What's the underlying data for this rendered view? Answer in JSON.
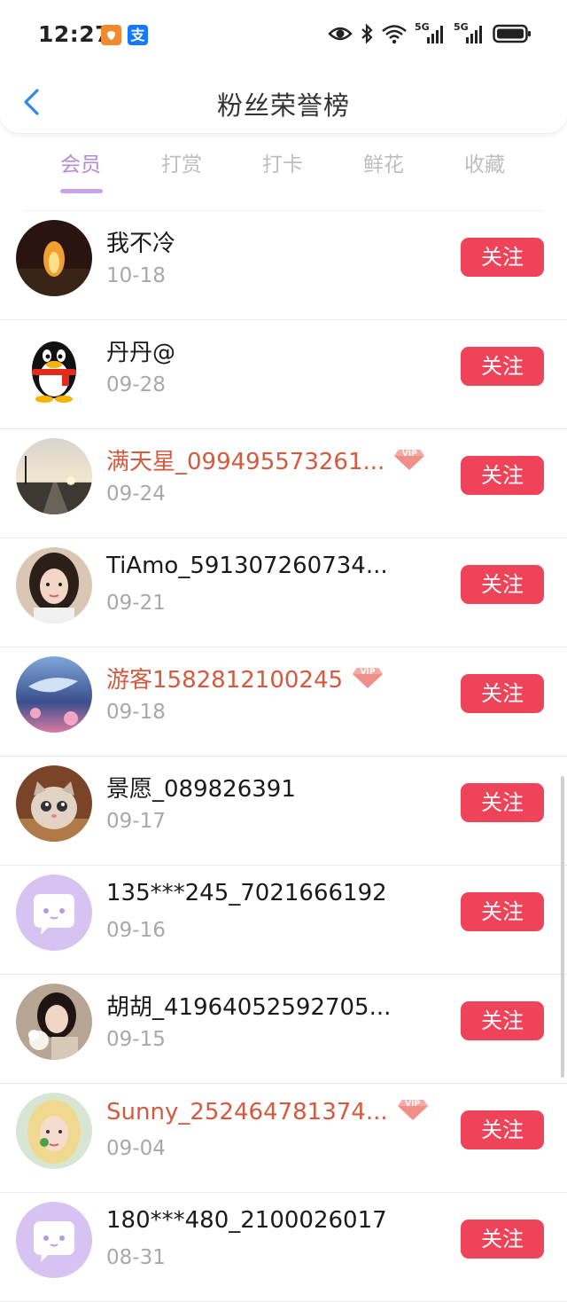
{
  "status_bar": {
    "time": "12:27",
    "alipay_glyph": "支",
    "icons": [
      "eye-icon",
      "bluetooth-icon",
      "wifi-icon",
      "signal-5g-icon",
      "signal-5g-icon",
      "battery-icon"
    ],
    "network_label": "5G"
  },
  "header": {
    "title": "粉丝荣誉榜"
  },
  "tabs": [
    {
      "label": "会员",
      "active": true
    },
    {
      "label": "打赏",
      "active": false
    },
    {
      "label": "打卡",
      "active": false
    },
    {
      "label": "鲜花",
      "active": false
    },
    {
      "label": "收藏",
      "active": false
    }
  ],
  "follow_label": "关注",
  "vip_badge": "VIP",
  "fans": [
    {
      "name": "我不冷",
      "date": "10-18",
      "vip": false,
      "avatar": "fire-photo"
    },
    {
      "name": "丹丹@",
      "date": "09-28",
      "vip": false,
      "avatar": "qq-penguin"
    },
    {
      "name": "满天星_099495573261...",
      "date": "09-24",
      "vip": true,
      "avatar": "sunset-railway-photo"
    },
    {
      "name": "TiAmo_591307260734...",
      "date": "09-21",
      "vip": false,
      "avatar": "girl-portrait-photo"
    },
    {
      "name": "游客1582812100245",
      "date": "09-18",
      "vip": true,
      "avatar": "whale-art-photo"
    },
    {
      "name": "景愿_089826391",
      "date": "09-17",
      "vip": false,
      "avatar": "kitten-photo"
    },
    {
      "name": "135***245_7021666192",
      "date": "09-16",
      "vip": false,
      "avatar": "default-chat-avatar"
    },
    {
      "name": "胡胡_41964052592705...",
      "date": "09-15",
      "vip": false,
      "avatar": "girl-flowers-photo"
    },
    {
      "name": "Sunny_252464781374...",
      "date": "09-04",
      "vip": true,
      "avatar": "blonde-girl-photo"
    },
    {
      "name": "180***480_2100026017",
      "date": "08-31",
      "vip": false,
      "avatar": "default-chat-avatar"
    }
  ],
  "colors": {
    "accent": "#c8a3e8",
    "follow_button": "#ee4358",
    "vip_name": "#d45a3f",
    "back_arrow": "#2f8ae5"
  }
}
